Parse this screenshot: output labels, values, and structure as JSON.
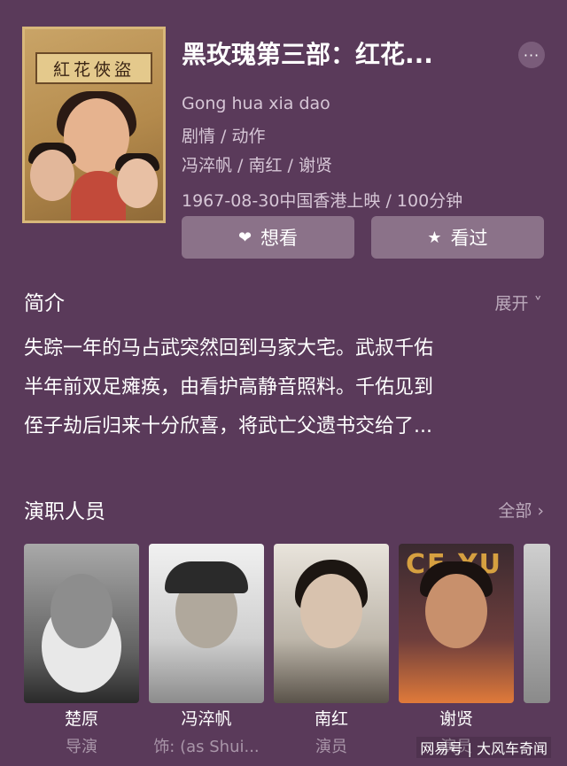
{
  "poster": {
    "banner_text": "紅花俠盜"
  },
  "movie": {
    "title": "黑玫瑰第三部：红花...",
    "original_title": "Gong hua xia dao",
    "genres": "剧情 / 动作",
    "cast_line": "冯淬帆 / 南红 / 谢贤",
    "release_line": "1967-08-30中国香港上映 / 100分钟"
  },
  "more_button": {
    "label": "···"
  },
  "actions": {
    "want_label": "想看",
    "seen_label": "看过"
  },
  "intro": {
    "title": "简介",
    "expand_label": "展开 ˅",
    "lines": [
      "失踪一年的马占武突然回到马家大宅。武叔千佑",
      "半年前双足瘫痪，由看护高静音照料。千佑见到",
      "侄子劫后归来十分欣喜，将武亡父遗书交给了..."
    ]
  },
  "cast": {
    "title": "演职人员",
    "all_label": "全部 ›",
    "poster_text_4": "CE YU",
    "members": [
      {
        "name": "楚原",
        "role": "导演"
      },
      {
        "name": "冯淬帆",
        "role": "饰: (as Shui..."
      },
      {
        "name": "南红",
        "role": "演员"
      },
      {
        "name": "谢贤",
        "role": "演员"
      }
    ]
  },
  "watermark": "网易号 | 大风车奇闻",
  "colors": {
    "background": "#5a3a5a",
    "button": "#8b7289"
  },
  "icons": {
    "want": "heart-icon",
    "seen": "star-icon",
    "more": "more-icon"
  }
}
